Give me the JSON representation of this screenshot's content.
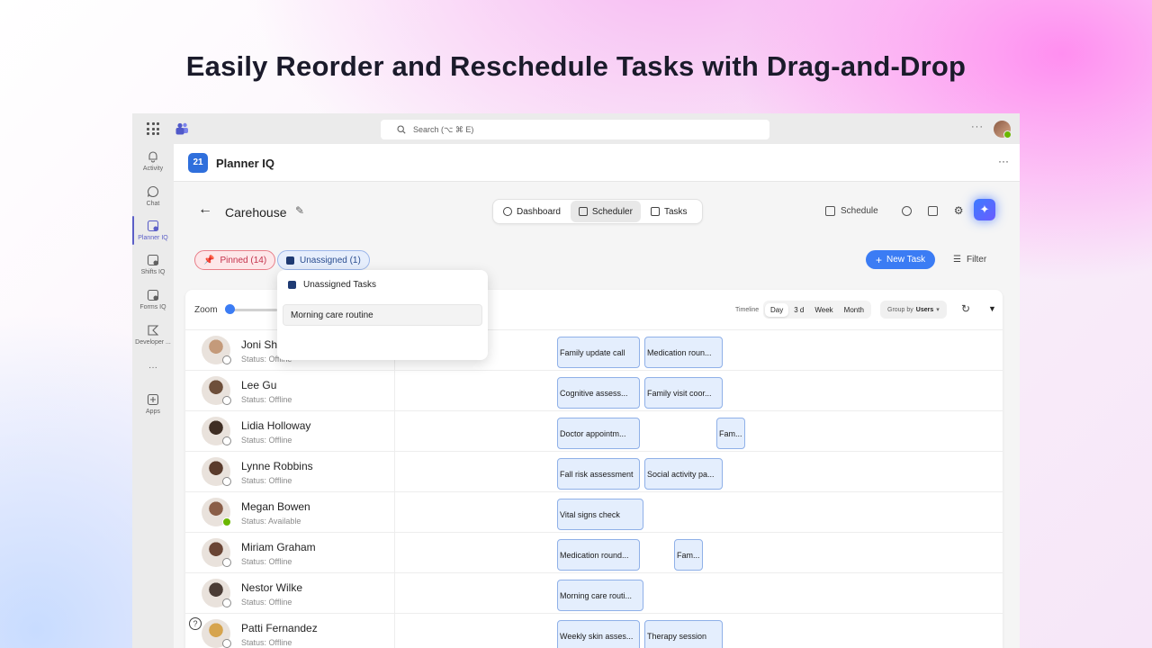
{
  "headline": "Easily Reorder and Reschedule Tasks with Drag-and-Drop",
  "topbar": {
    "search_placeholder": "Search (⌥ ⌘ E)",
    "more_label": "···"
  },
  "rail": {
    "items": [
      {
        "label": "Activity"
      },
      {
        "label": "Chat"
      },
      {
        "label": "Planner IQ"
      },
      {
        "label": "Shifts IQ"
      },
      {
        "label": "Forms IQ"
      },
      {
        "label": "Developer ..."
      },
      {
        "label": "···"
      },
      {
        "label": "Apps"
      }
    ]
  },
  "app": {
    "logo_text": "21",
    "title": "Planner IQ",
    "more_label": "···"
  },
  "page": {
    "back_label": "←",
    "title": "Carehouse"
  },
  "views": {
    "tabs": [
      {
        "label": "Dashboard"
      },
      {
        "label": "Scheduler"
      },
      {
        "label": "Tasks"
      }
    ],
    "active": "Scheduler"
  },
  "tools": {
    "schedule_label": "Schedule"
  },
  "filters": {
    "pinned_label": "Pinned (14)",
    "unassigned_label": "Unassigned (1)",
    "new_task_label": "New Task",
    "filter_label": "Filter"
  },
  "panel": {
    "zoom_label": "Zoom",
    "zoom_level": 0,
    "timeline_label": "Timeline",
    "timeline_options": [
      "Day",
      "3 d",
      "Week",
      "Month"
    ],
    "timeline_active": "Day",
    "groupby_label": "Group by",
    "groupby_value": "Users"
  },
  "users": [
    {
      "name": "Joni Sh",
      "status": "Status: Offline",
      "presence": "offline",
      "tasks": [
        "Family update call",
        "Medication roun..."
      ]
    },
    {
      "name": "Lee Gu",
      "status": "Status: Offline",
      "presence": "offline",
      "tasks": [
        "Cognitive assess...",
        "Family visit coor..."
      ]
    },
    {
      "name": "Lidia Holloway",
      "status": "Status: Offline",
      "presence": "offline",
      "tasks": [
        "Doctor appointm...",
        "Fam..."
      ]
    },
    {
      "name": "Lynne Robbins",
      "status": "Status: Offline",
      "presence": "offline",
      "tasks": [
        "Fall risk assessment",
        "Social activity pa..."
      ]
    },
    {
      "name": "Megan Bowen",
      "status": "Status: Available",
      "presence": "available",
      "tasks": [
        "Vital signs check"
      ]
    },
    {
      "name": "Miriam Graham",
      "status": "Status: Offline",
      "presence": "offline",
      "tasks": [
        "Medication round...",
        "Fam..."
      ]
    },
    {
      "name": "Nestor Wilke",
      "status": "Status: Offline",
      "presence": "offline",
      "tasks": [
        "Morning care routi..."
      ]
    },
    {
      "name": "Patti Fernandez",
      "status": "Status: Offline",
      "presence": "offline",
      "tasks": [
        "Weekly skin asses...",
        "Therapy session"
      ]
    }
  ],
  "popup": {
    "title": "Unassigned Tasks",
    "items": [
      "Morning care routine"
    ]
  },
  "colors": {
    "accent": "#3b7cf4",
    "teams_purple": "#5b5fc7",
    "task_bg": "#e4eefd",
    "task_border": "#8fb0e8",
    "pinned": "#d13438",
    "available": "#6bb700"
  }
}
